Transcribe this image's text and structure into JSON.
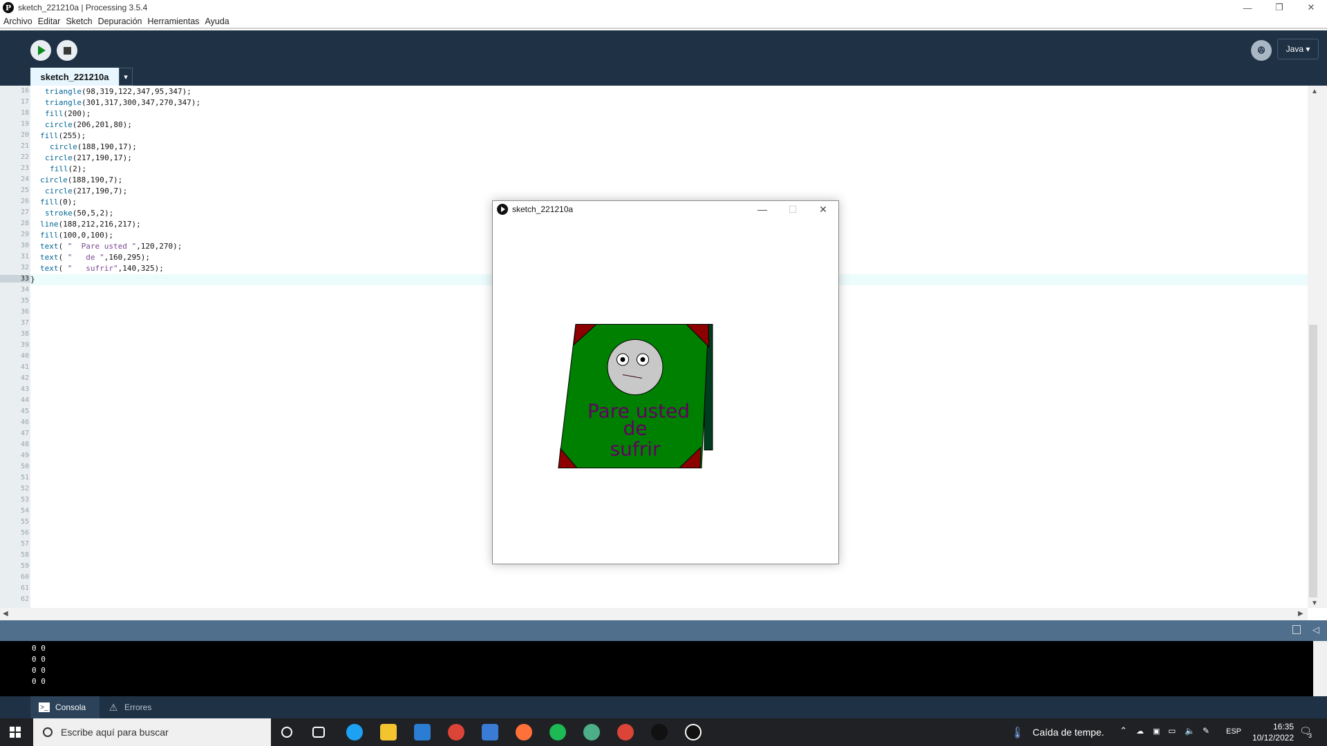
{
  "window": {
    "title": "sketch_221210a | Processing 3.5.4",
    "app_icon_glyph": "P",
    "controls": {
      "minimize": "—",
      "restore": "❐",
      "close": "✕"
    }
  },
  "menu": [
    "Archivo",
    "Editar",
    "Sketch",
    "Depuración",
    "Herramientas",
    "Ayuda"
  ],
  "toolbar": {
    "mode_label": "Java ▾",
    "debug_glyph": "ꔮ",
    "run_icon": "play-icon",
    "stop_icon": "stop-icon"
  },
  "tab": {
    "name": "sketch_221210a",
    "arrow": "▾"
  },
  "editor": {
    "active_line": "33",
    "line_numbers": [
      "16",
      "17",
      "18",
      "19",
      "20",
      "21",
      "22",
      "23",
      "24",
      "25",
      "26",
      "27",
      "28",
      "29",
      "30",
      "31",
      "32",
      "33",
      "34",
      "35",
      "36",
      "37",
      "38",
      "39",
      "40",
      "41",
      "42",
      "43",
      "44",
      "45",
      "46",
      "47",
      "48",
      "49",
      "50",
      "51",
      "52",
      "53",
      "54",
      "55",
      "56",
      "57",
      "58",
      "59",
      "60",
      "61",
      "62"
    ],
    "code": [
      {
        "indent": 1,
        "parts": [
          {
            "t": "triangle",
            "c": "#006699"
          },
          {
            "t": "(98,319,122,347,95,347);",
            "c": "#111111"
          }
        ]
      },
      {
        "indent": 1,
        "parts": [
          {
            "t": "triangle",
            "c": "#006699"
          },
          {
            "t": "(301,317,300,347,270,347);",
            "c": "#111111"
          }
        ]
      },
      {
        "indent": 1,
        "parts": [
          {
            "t": "fill",
            "c": "#006699"
          },
          {
            "t": "(200);",
            "c": "#111111"
          }
        ]
      },
      {
        "indent": 1,
        "parts": [
          {
            "t": "circle",
            "c": "#006699"
          },
          {
            "t": "(206,201,80);",
            "c": "#111111"
          }
        ]
      },
      {
        "indent": 0,
        "parts": [
          {
            "t": "fill",
            "c": "#006699"
          },
          {
            "t": "(255);",
            "c": "#111111"
          }
        ]
      },
      {
        "indent": 2,
        "parts": [
          {
            "t": "circle",
            "c": "#006699"
          },
          {
            "t": "(188,190,17);",
            "c": "#111111"
          }
        ]
      },
      {
        "indent": 1,
        "parts": [
          {
            "t": "circle",
            "c": "#006699"
          },
          {
            "t": "(217,190,17);",
            "c": "#111111"
          }
        ]
      },
      {
        "indent": 2,
        "parts": [
          {
            "t": "fill",
            "c": "#006699"
          },
          {
            "t": "(2);",
            "c": "#111111"
          }
        ]
      },
      {
        "indent": 0,
        "parts": [
          {
            "t": "circle",
            "c": "#006699"
          },
          {
            "t": "(188,190,7);",
            "c": "#111111"
          }
        ]
      },
      {
        "indent": 1,
        "parts": [
          {
            "t": "circle",
            "c": "#006699"
          },
          {
            "t": "(217,190,7);",
            "c": "#111111"
          }
        ]
      },
      {
        "indent": 0,
        "parts": [
          {
            "t": "fill",
            "c": "#006699"
          },
          {
            "t": "(0);",
            "c": "#111111"
          }
        ]
      },
      {
        "indent": 1,
        "parts": [
          {
            "t": "stroke",
            "c": "#006699"
          },
          {
            "t": "(50,5,2);",
            "c": "#111111"
          }
        ]
      },
      {
        "indent": 0,
        "parts": [
          {
            "t": "line",
            "c": "#006699"
          },
          {
            "t": "(188,212,216,217);",
            "c": "#111111"
          }
        ]
      },
      {
        "indent": 0,
        "parts": [
          {
            "t": "fill",
            "c": "#006699"
          },
          {
            "t": "(100,0,100);",
            "c": "#111111"
          }
        ]
      },
      {
        "indent": 0,
        "parts": [
          {
            "t": "text",
            "c": "#006699"
          },
          {
            "t": "( ",
            "c": "#111111"
          },
          {
            "t": "\"  Pare usted \"",
            "c": "#7d4793"
          },
          {
            "t": ",120,270);",
            "c": "#111111"
          }
        ]
      },
      {
        "indent": 0,
        "parts": [
          {
            "t": "text",
            "c": "#006699"
          },
          {
            "t": "( ",
            "c": "#111111"
          },
          {
            "t": "\"   de \"",
            "c": "#7d4793"
          },
          {
            "t": ",160,295);",
            "c": "#111111"
          }
        ]
      },
      {
        "indent": 0,
        "parts": [
          {
            "t": "text",
            "c": "#006699"
          },
          {
            "t": "( ",
            "c": "#111111"
          },
          {
            "t": "\"   sufrir\"",
            "c": "#7d4793"
          },
          {
            "t": ",140,325);",
            "c": "#111111"
          }
        ]
      },
      {
        "indent": -1,
        "parts": [
          {
            "t": "}",
            "c": "#111111"
          }
        ]
      }
    ]
  },
  "console": {
    "lines": [
      "0 0",
      "0 0",
      "0 0",
      "0 0"
    ],
    "tabs": {
      "console": "Consola",
      "errors": "Errores"
    }
  },
  "sketch_window": {
    "title": "sketch_221210a",
    "controls": {
      "minimize": "—",
      "maximize": "☐",
      "close": "✕"
    },
    "text_lines": [
      "Pare usted",
      "de",
      "sufrir"
    ],
    "colors": {
      "card": "#008000",
      "corners": "#8b0000",
      "flap": "#003d1f",
      "face": "#c8c8c8",
      "text": "#640064"
    }
  },
  "taskbar": {
    "search_placeholder": "Escribe aquí para buscar",
    "weather": "Caída de tempe.",
    "language": "ESP",
    "time": "16:35",
    "date": "10/12/2022",
    "notifications": "3",
    "apps": [
      "task-view-icon",
      "edge-icon",
      "explorer-icon",
      "mail-icon",
      "chrome-icon",
      "store-icon",
      "firefox-icon",
      "spotify-icon",
      "web-icon",
      "chrome-icon",
      "processing-icon",
      "sketch-run-icon"
    ]
  }
}
